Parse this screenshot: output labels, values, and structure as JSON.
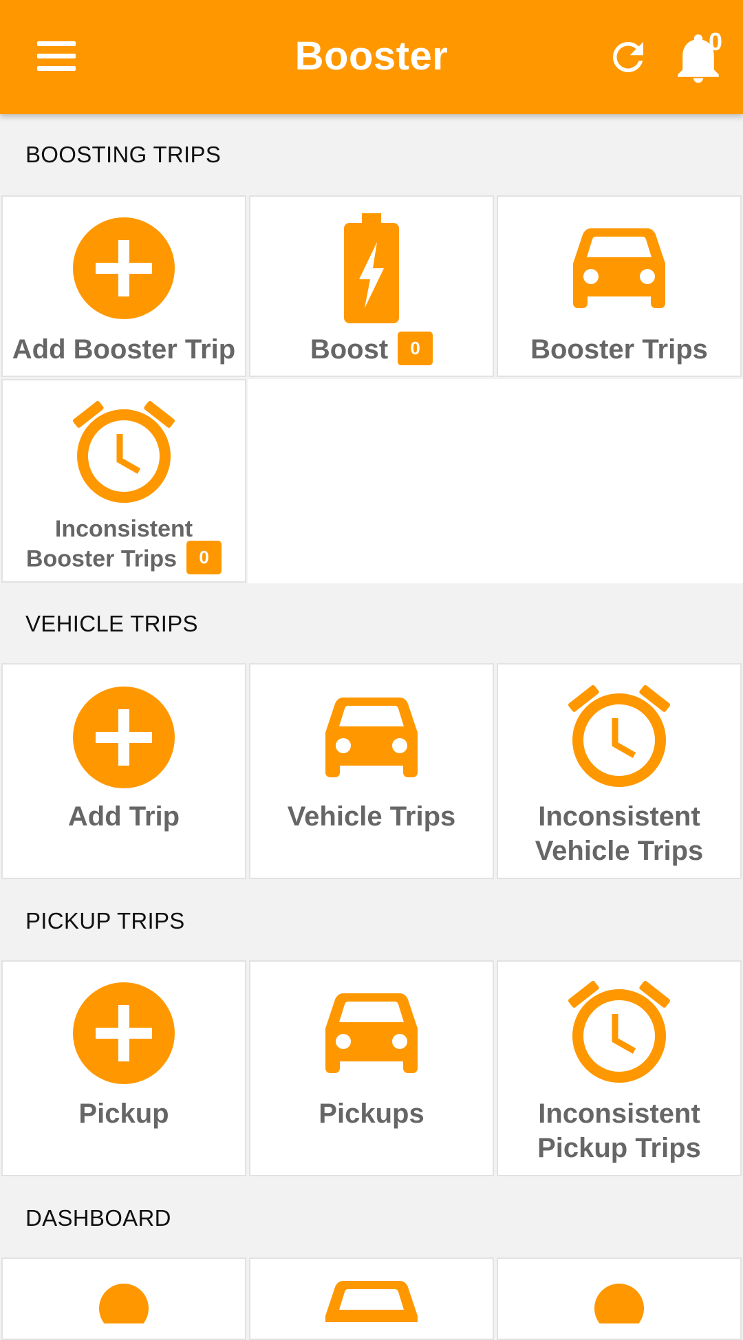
{
  "appbar": {
    "title": "Booster",
    "notification_count": "0",
    "icons": {
      "menu": "menu-icon",
      "refresh": "refresh-icon",
      "bell": "bell-icon"
    },
    "color": "#ff9800"
  },
  "sections": [
    {
      "title": "BOOSTING TRIPS",
      "tiles": [
        {
          "label": "Add Booster Trip",
          "icon": "add-circle-icon"
        },
        {
          "label": "Boost",
          "icon": "battery-charging-icon",
          "badge": "0"
        },
        {
          "label": "Booster Trips",
          "icon": "car-icon"
        },
        {
          "label_line1": "Inconsistent",
          "label_line2": "Booster Trips",
          "icon": "alarm-clock-icon",
          "badge": "0"
        }
      ]
    },
    {
      "title": "VEHICLE TRIPS",
      "tiles": [
        {
          "label": "Add Trip",
          "icon": "add-circle-icon"
        },
        {
          "label": "Vehicle Trips",
          "icon": "car-icon"
        },
        {
          "label_line1": "Inconsistent",
          "label_line2": "Vehicle Trips",
          "icon": "alarm-clock-icon"
        }
      ]
    },
    {
      "title": "PICKUP TRIPS",
      "tiles": [
        {
          "label": "Pickup",
          "icon": "add-circle-icon"
        },
        {
          "label": "Pickups",
          "icon": "car-icon"
        },
        {
          "label_line1": "Inconsistent",
          "label_line2": "Pickup Trips",
          "icon": "alarm-clock-icon"
        }
      ]
    },
    {
      "title": "DASHBOARD",
      "tiles": [
        {
          "icon": "person-icon"
        },
        {
          "icon": "car-icon"
        },
        {
          "icon": "person-icon"
        }
      ]
    }
  ]
}
